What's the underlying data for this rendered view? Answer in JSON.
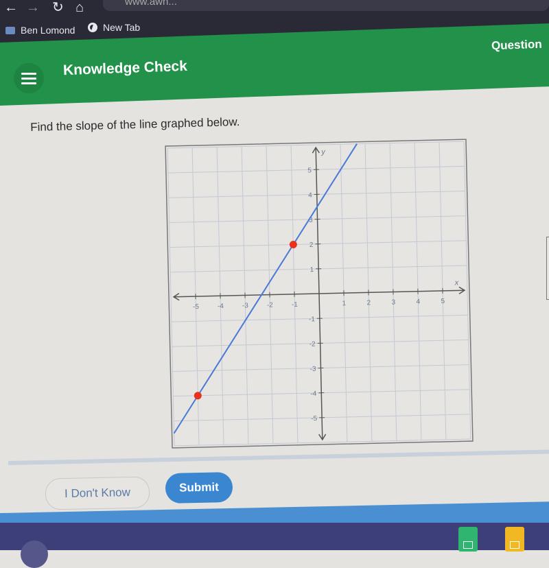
{
  "browser": {
    "url_partial": "www.awh...",
    "bookmarks": [
      {
        "label": "Ben Lomond",
        "icon": "folder-icon"
      },
      {
        "label": "New Tab",
        "icon": "globe-icon"
      }
    ],
    "nav_icons": [
      "back-arrow-icon",
      "forward-arrow-icon",
      "reload-icon",
      "home-icon"
    ],
    "glyphs": {
      "back": "←",
      "forward": "→",
      "reload": "↻",
      "home": "⌂"
    }
  },
  "header": {
    "title": "Knowledge Check",
    "question_label": "Question",
    "accent_color": "#22914a"
  },
  "question": {
    "prompt": "Find the slope of the line graphed below."
  },
  "chart_data": {
    "type": "line",
    "title": "",
    "xlabel": "x",
    "ylabel": "y",
    "xlim": [
      -6,
      6
    ],
    "ylim": [
      -6,
      6
    ],
    "grid": true,
    "x_ticks": [
      -5,
      -4,
      -3,
      -2,
      -1,
      1,
      2,
      3,
      4,
      5
    ],
    "y_ticks": [
      -5,
      -4,
      -3,
      -2,
      -1,
      1,
      2,
      3,
      4,
      5
    ],
    "series": [
      {
        "name": "line",
        "slope": 1.5,
        "intercept": 3.5,
        "color": "#4a78d8"
      }
    ],
    "points": [
      {
        "x": -1,
        "y": 2,
        "color": "#e8321e"
      },
      {
        "x": -5,
        "y": -4,
        "color": "#e8321e"
      }
    ]
  },
  "actions": {
    "dont_know_label": "I Don't Know",
    "submit_label": "Submit",
    "submit_color": "#3b86d0"
  },
  "taskbar": {
    "apps": [
      {
        "name": "sheets",
        "color": "#2fb56f"
      },
      {
        "name": "slides",
        "color": "#f2b824"
      }
    ]
  }
}
